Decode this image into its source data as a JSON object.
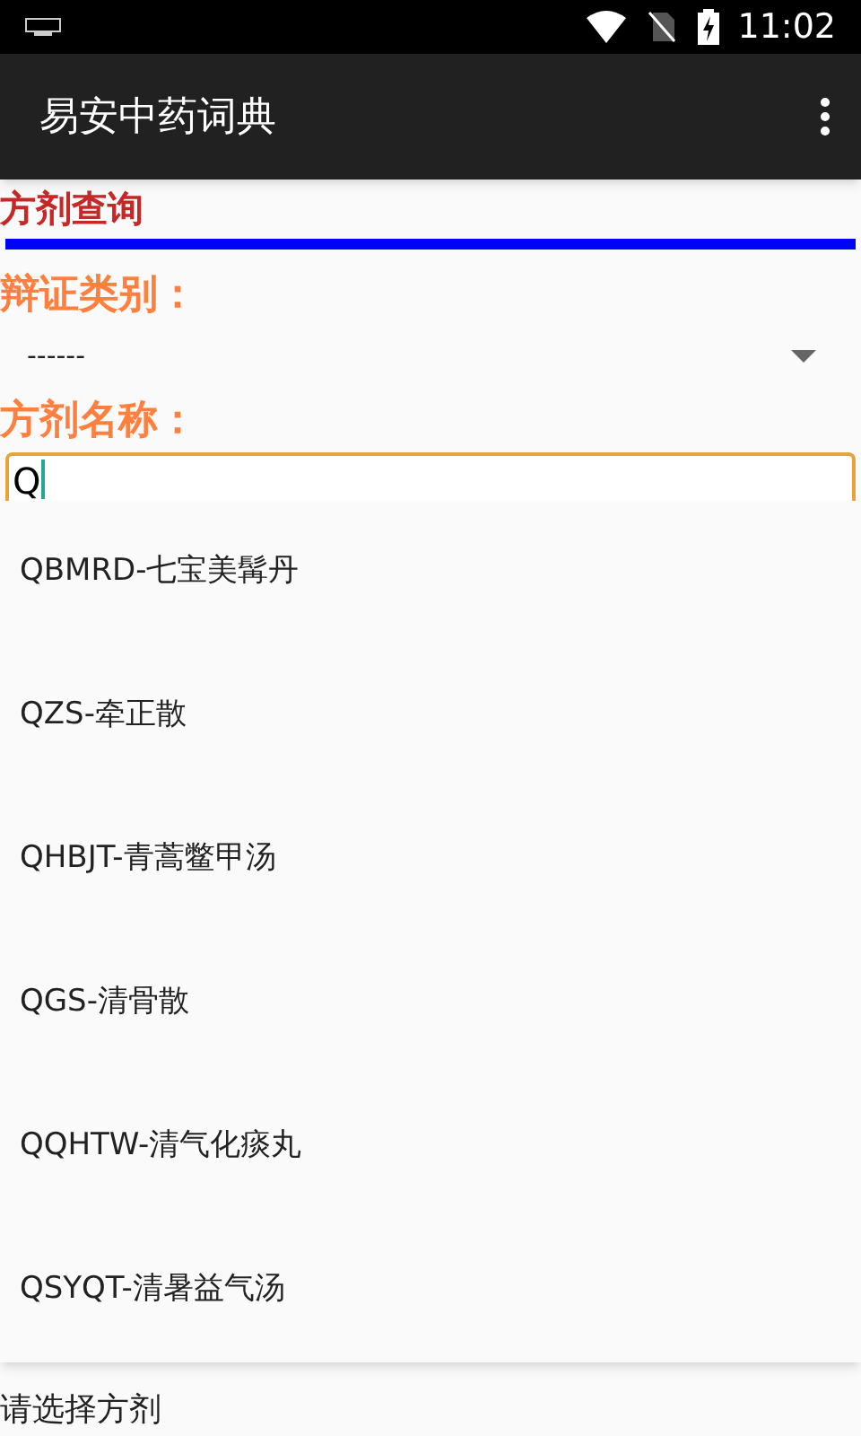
{
  "status_bar": {
    "time": "11:02"
  },
  "app_bar": {
    "title": "易安中药词典"
  },
  "section_title": "方剂查询",
  "category": {
    "label": "辩证类别：",
    "value": "------"
  },
  "name_field": {
    "label": "方剂名称：",
    "value": "Q"
  },
  "suggestions": [
    "QBMRD-七宝美髯丹",
    "QZS-牵正散",
    "QHBJT-青蒿鳖甲汤",
    "QGS-清骨散",
    "QQHTW-清气化痰丸",
    "QSYQT-清暑益气汤"
  ],
  "footer_text": "请选择方剂"
}
